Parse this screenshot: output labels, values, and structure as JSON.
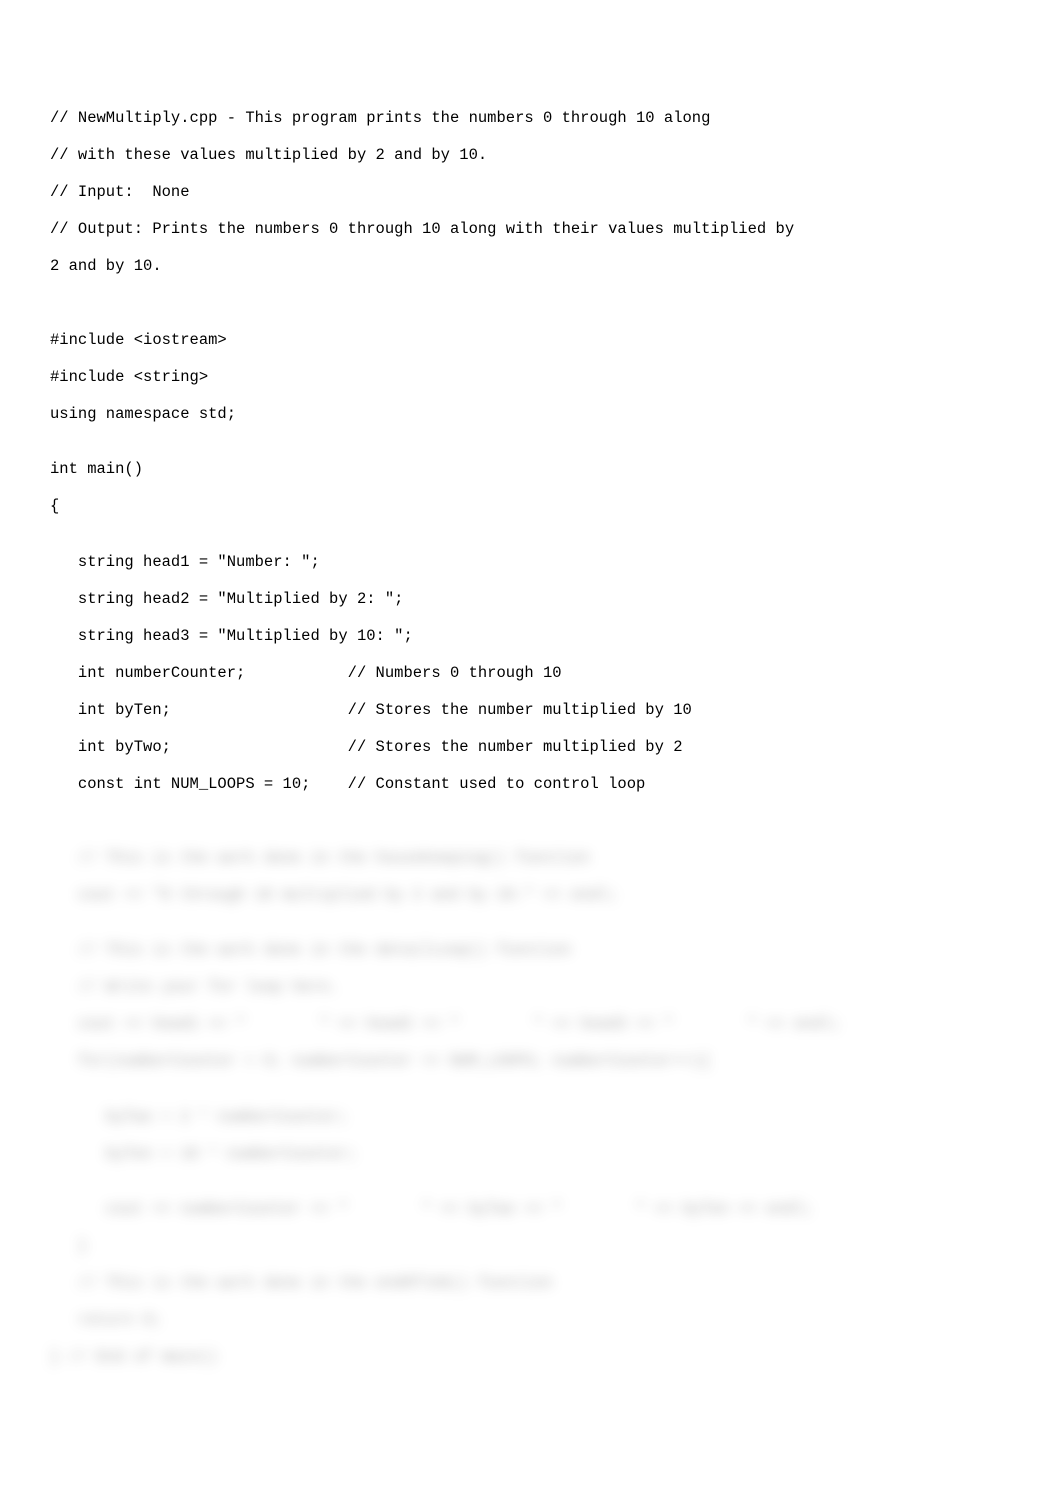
{
  "code": {
    "l1": "// NewMultiply.cpp - This program prints the numbers 0 through 10 along",
    "l2": "// with these values multiplied by 2 and by 10.",
    "l3": "// Input:  None",
    "l4": "// Output: Prints the numbers 0 through 10 along with their values multiplied by",
    "l5": "2 and by 10.",
    "l6": "",
    "l7": "",
    "l8": "#include <iostream>",
    "l9": "#include <string>",
    "l10": "using namespace std;",
    "l11": "",
    "l12": "int main()",
    "l13": "{",
    "l14": "",
    "l15": "   string head1 = \"Number: \";",
    "l16": "   string head2 = \"Multiplied by 2: \";",
    "l17": "   string head3 = \"Multiplied by 10: \";",
    "l18": "   int numberCounter;           // Numbers 0 through 10",
    "l19": "   int byTen;                   // Stores the number multiplied by 10",
    "l20": "   int byTwo;                   // Stores the number multiplied by 2",
    "l21": "   const int NUM_LOOPS = 10;    // Constant used to control loop",
    "l22": ""
  },
  "blurred": {
    "b1": "   // This is the work done in the housekeeping() function",
    "b2": "   cout << \"0 through 10 multiplied by 2 and by 10.\" << endl;",
    "b3": "",
    "b4": "   // This is the work done in the detailLoop() function",
    "b5": "   // Write your for loop here.",
    "b6": "   cout << head1 << \"        \" << head2 << \"        \" << head3 << \"        \" << endl;",
    "b7": "   for(numberCounter = 0; numberCounter <= NUM_LOOPS; numberCounter++){ ",
    "b8": "",
    "b9": "      byTwo = 2 * numberCounter;",
    "b10": "      byTen = 10 * numberCounter;",
    "b11": "",
    "b12": "      cout << numberCounter << \"        \" << byTwo << \"        \" << byTen << endl;",
    "b13": "   }",
    "b14": "   // This is the work done in the endOfJob() function",
    "b15": "   return 0;",
    "b16": "} // End of main()"
  }
}
